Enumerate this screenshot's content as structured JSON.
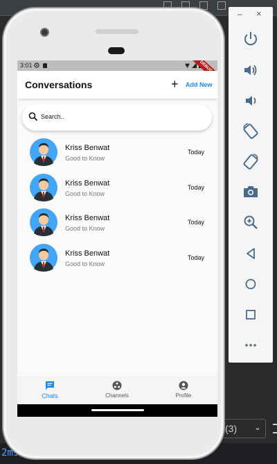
{
  "ide": {
    "console_text": "2ms",
    "dropdown_value": "(3)"
  },
  "status_bar": {
    "time": "3:01",
    "debug_banner": "DEBUG"
  },
  "app_bar": {
    "title": "Conversations",
    "add_icon": "plus-icon",
    "add_label": "Add New"
  },
  "search": {
    "placeholder": "Search..",
    "icon": "search-icon"
  },
  "conversations": [
    {
      "name": "Kriss Benwat",
      "message": "Good to Know",
      "time": "Today",
      "avatar": "person-avatar"
    },
    {
      "name": "Kriss Benwat",
      "message": "Good to Know",
      "time": "Today",
      "avatar": "person-avatar"
    },
    {
      "name": "Kriss Benwat",
      "message": "Good to Know",
      "time": "Today",
      "avatar": "person-avatar"
    },
    {
      "name": "Kriss Benwat",
      "message": "Good to Know",
      "time": "Today",
      "avatar": "person-avatar"
    }
  ],
  "bottom_nav": [
    {
      "label": "Chats",
      "icon": "chat-icon",
      "active": true
    },
    {
      "label": "Channels",
      "icon": "channels-icon",
      "active": false
    },
    {
      "label": "Profile",
      "icon": "profile-icon",
      "active": false
    }
  ],
  "emulator": {
    "minimize_label": "–",
    "close_label": "×",
    "buttons": [
      "power-icon",
      "volume-up-icon",
      "volume-down-icon",
      "rotate-left-icon",
      "rotate-right-icon",
      "camera-icon",
      "zoom-icon",
      "back-icon",
      "home-icon",
      "overview-icon",
      "more-icon"
    ]
  },
  "colors": {
    "accent": "#1e88e5",
    "avatar_bg": "#42a5f5",
    "debug_ribbon": "#b71c1c"
  }
}
